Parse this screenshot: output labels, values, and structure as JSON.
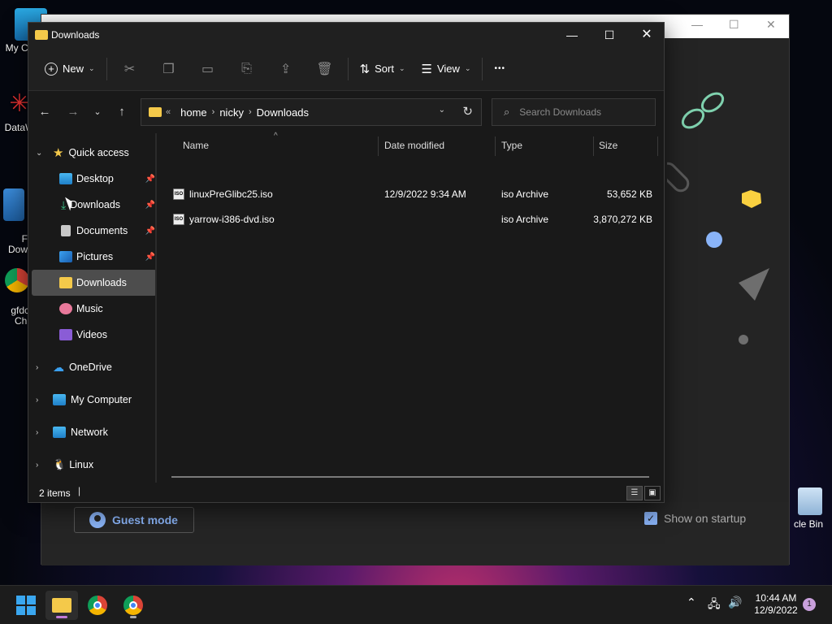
{
  "desktop": {
    "icons": [
      {
        "label": "My Co"
      },
      {
        "label": "DataW"
      },
      {
        "label": "F\nDow"
      },
      {
        "label": "gfdc\nChi"
      }
    ],
    "recycle_label": "cle Bin"
  },
  "bg_app": {
    "guest_label": "Guest mode",
    "startup_label": "Show on startup"
  },
  "explorer": {
    "title": "Downloads",
    "toolbar": {
      "new_label": "New",
      "sort_label": "Sort",
      "view_label": "View",
      "more_label": "•••"
    },
    "address": {
      "crumbs": [
        "home",
        "nicky",
        "Downloads"
      ]
    },
    "search_placeholder": "Search Downloads",
    "sidebar": {
      "quick_access": "Quick access",
      "items": [
        {
          "label": "Desktop",
          "pinned": true
        },
        {
          "label": "Downloads",
          "pinned": true
        },
        {
          "label": "Documents",
          "pinned": true
        },
        {
          "label": "Pictures",
          "pinned": true
        },
        {
          "label": "Downloads",
          "pinned": false
        },
        {
          "label": "Music",
          "pinned": false
        },
        {
          "label": "Videos",
          "pinned": false
        }
      ],
      "locations": [
        "OneDrive",
        "My Computer",
        "Network",
        "Linux"
      ]
    },
    "columns": {
      "name": "Name",
      "date": "Date modified",
      "type": "Type",
      "size": "Size"
    },
    "files": [
      {
        "name": "linuxPreGlibc25.iso",
        "date": "12/9/2022 9:34 AM",
        "type": "iso Archive",
        "size": "53,652 KB"
      },
      {
        "name": "yarrow-i386-dvd.iso",
        "date": "",
        "type": "iso Archive",
        "size": "3,870,272 KB"
      }
    ],
    "status": "2 items"
  },
  "taskbar": {
    "time": "10:44 AM",
    "date": "12/9/2022",
    "notifications": "1"
  }
}
